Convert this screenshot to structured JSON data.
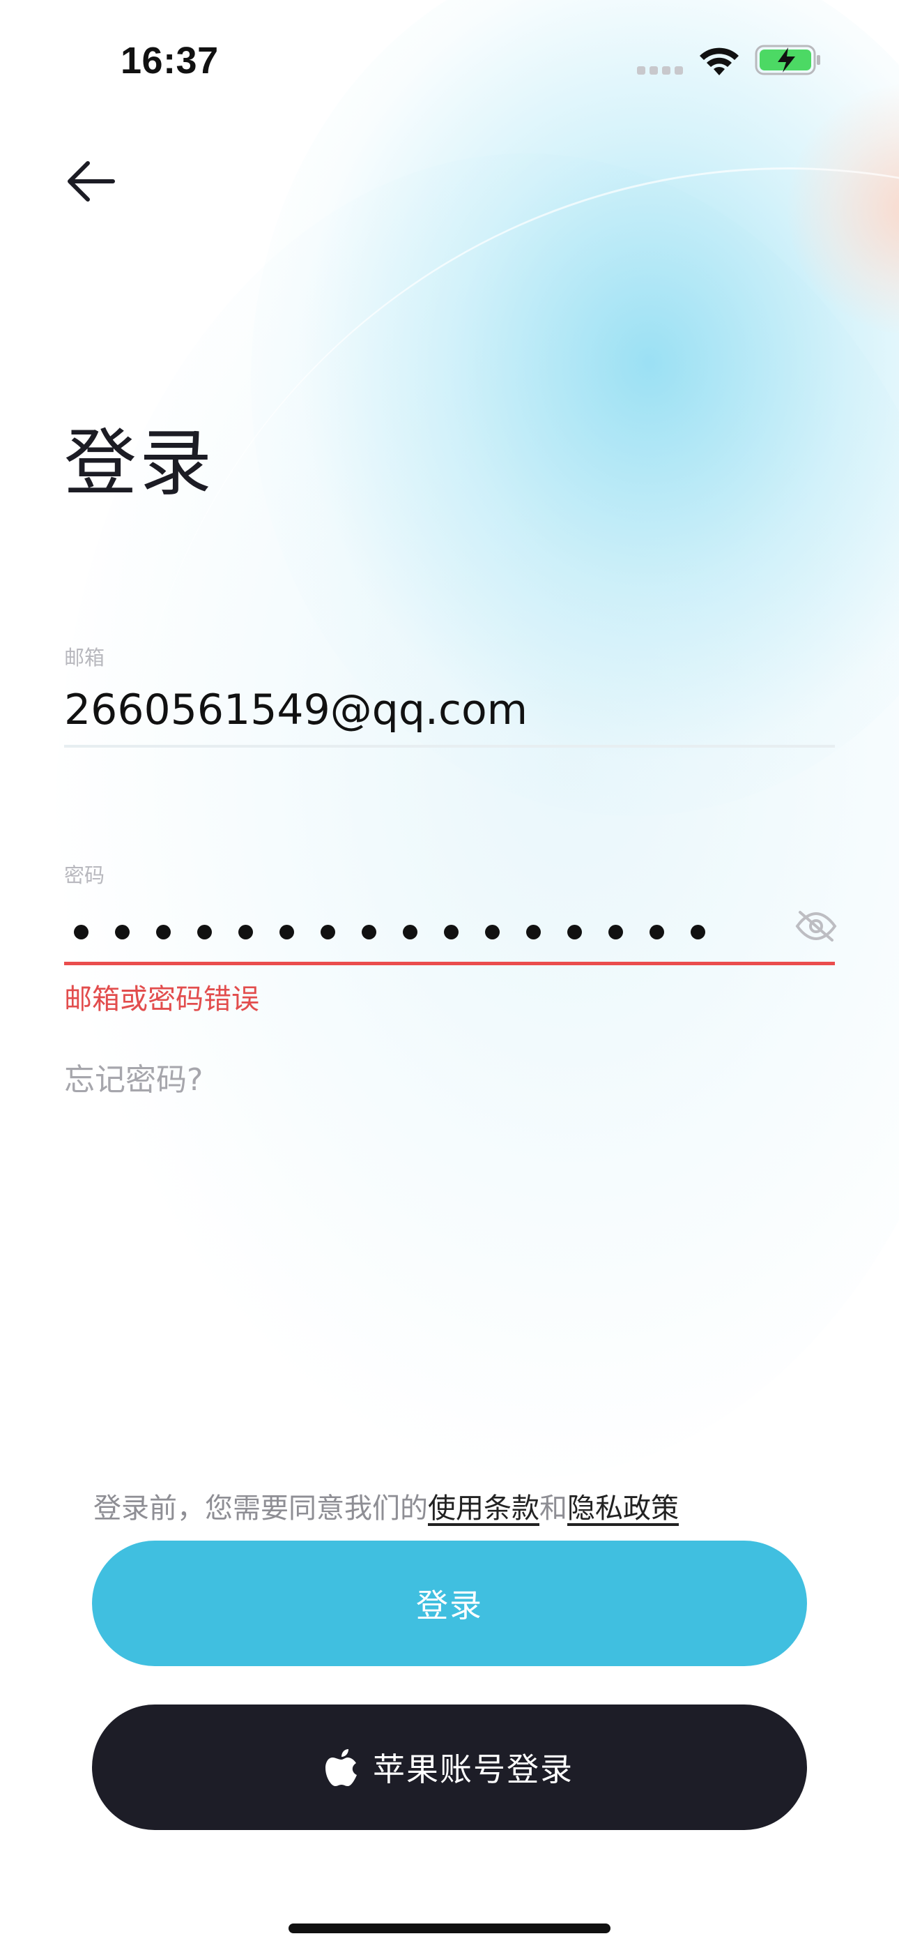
{
  "status_bar": {
    "time": "16:37",
    "battery_color": "#4cd964",
    "icons": [
      "cellular-signal-icon",
      "wifi-icon",
      "battery-charging-icon"
    ]
  },
  "header": {
    "back_icon": "arrow-left-icon",
    "title": "登录"
  },
  "form": {
    "email_label": "邮箱",
    "email_value": "2660561549@qq.com",
    "password_label": "密码",
    "password_masked_length": 16,
    "password_toggle_icon": "eye-off-icon",
    "error_message": "邮箱或密码错误",
    "error_color": "#e24d4d",
    "forgot_password": "忘记密码?"
  },
  "terms": {
    "prefix": "登录前，您需要同意我们的",
    "terms_link": "使用条款",
    "conjunction": "和",
    "privacy_link": "隐私政策"
  },
  "buttons": {
    "login_label": "登录",
    "login_color": "#40bfe0",
    "apple_login_label": "苹果账号登录",
    "apple_icon": "apple-logo-icon",
    "apple_color": "#1d1d27"
  }
}
